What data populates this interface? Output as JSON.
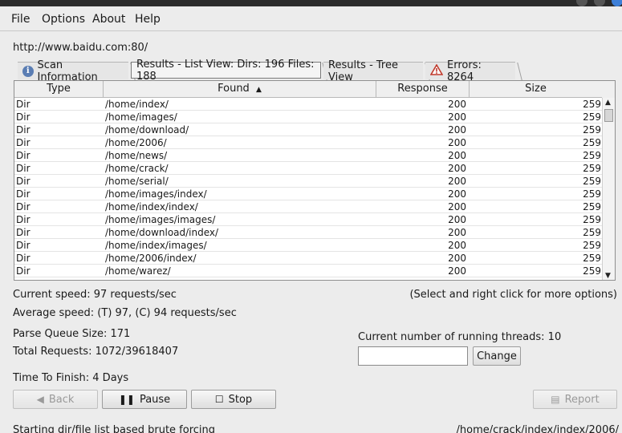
{
  "menu": [
    "File",
    "Options",
    "About",
    "Help"
  ],
  "url": "http://www.baidu.com:80/",
  "tabs": {
    "scan_info": "Scan Information",
    "list_view": "Results - List View: Dirs: 196 Files: 188",
    "tree_view": "Results - Tree View",
    "errors": "Errors: 8264"
  },
  "table": {
    "headers": {
      "type": "Type",
      "found": "Found",
      "response": "Response",
      "size": "Size"
    },
    "rows": [
      {
        "type": "Dir",
        "found": "/home/index/",
        "response": "200",
        "size": "259"
      },
      {
        "type": "Dir",
        "found": "/home/images/",
        "response": "200",
        "size": "259"
      },
      {
        "type": "Dir",
        "found": "/home/download/",
        "response": "200",
        "size": "259"
      },
      {
        "type": "Dir",
        "found": "/home/2006/",
        "response": "200",
        "size": "259"
      },
      {
        "type": "Dir",
        "found": "/home/news/",
        "response": "200",
        "size": "259"
      },
      {
        "type": "Dir",
        "found": "/home/crack/",
        "response": "200",
        "size": "259"
      },
      {
        "type": "Dir",
        "found": "/home/serial/",
        "response": "200",
        "size": "259"
      },
      {
        "type": "Dir",
        "found": "/home/images/index/",
        "response": "200",
        "size": "259"
      },
      {
        "type": "Dir",
        "found": "/home/index/index/",
        "response": "200",
        "size": "259"
      },
      {
        "type": "Dir",
        "found": "/home/images/images/",
        "response": "200",
        "size": "259"
      },
      {
        "type": "Dir",
        "found": "/home/download/index/",
        "response": "200",
        "size": "259"
      },
      {
        "type": "Dir",
        "found": "/home/index/images/",
        "response": "200",
        "size": "259"
      },
      {
        "type": "Dir",
        "found": "/home/2006/index/",
        "response": "200",
        "size": "259"
      },
      {
        "type": "Dir",
        "found": "/home/warez/",
        "response": "200",
        "size": "259"
      }
    ]
  },
  "status": {
    "current_speed": "Current speed: 97 requests/sec",
    "hint": "(Select and right click for more options)",
    "average_speed": "Average speed: (T) 97, (C) 94 requests/sec",
    "parse_queue": "Parse Queue Size: 171",
    "threads_label": "Current number of running threads: 10",
    "total_requests": "Total Requests: 1072/39618407",
    "time_to_finish": "Time To Finish: 4 Days",
    "footer_left": "Starting dir/file list based brute forcing",
    "footer_right": "/home/crack/index/index/2006/"
  },
  "threads_input_value": "",
  "buttons": {
    "change": "Change",
    "back": "Back",
    "pause": "Pause",
    "stop": "Stop",
    "report": "Report"
  },
  "colors": {
    "info_icon": "#5a7db3",
    "error_icon": "#c0392b"
  }
}
